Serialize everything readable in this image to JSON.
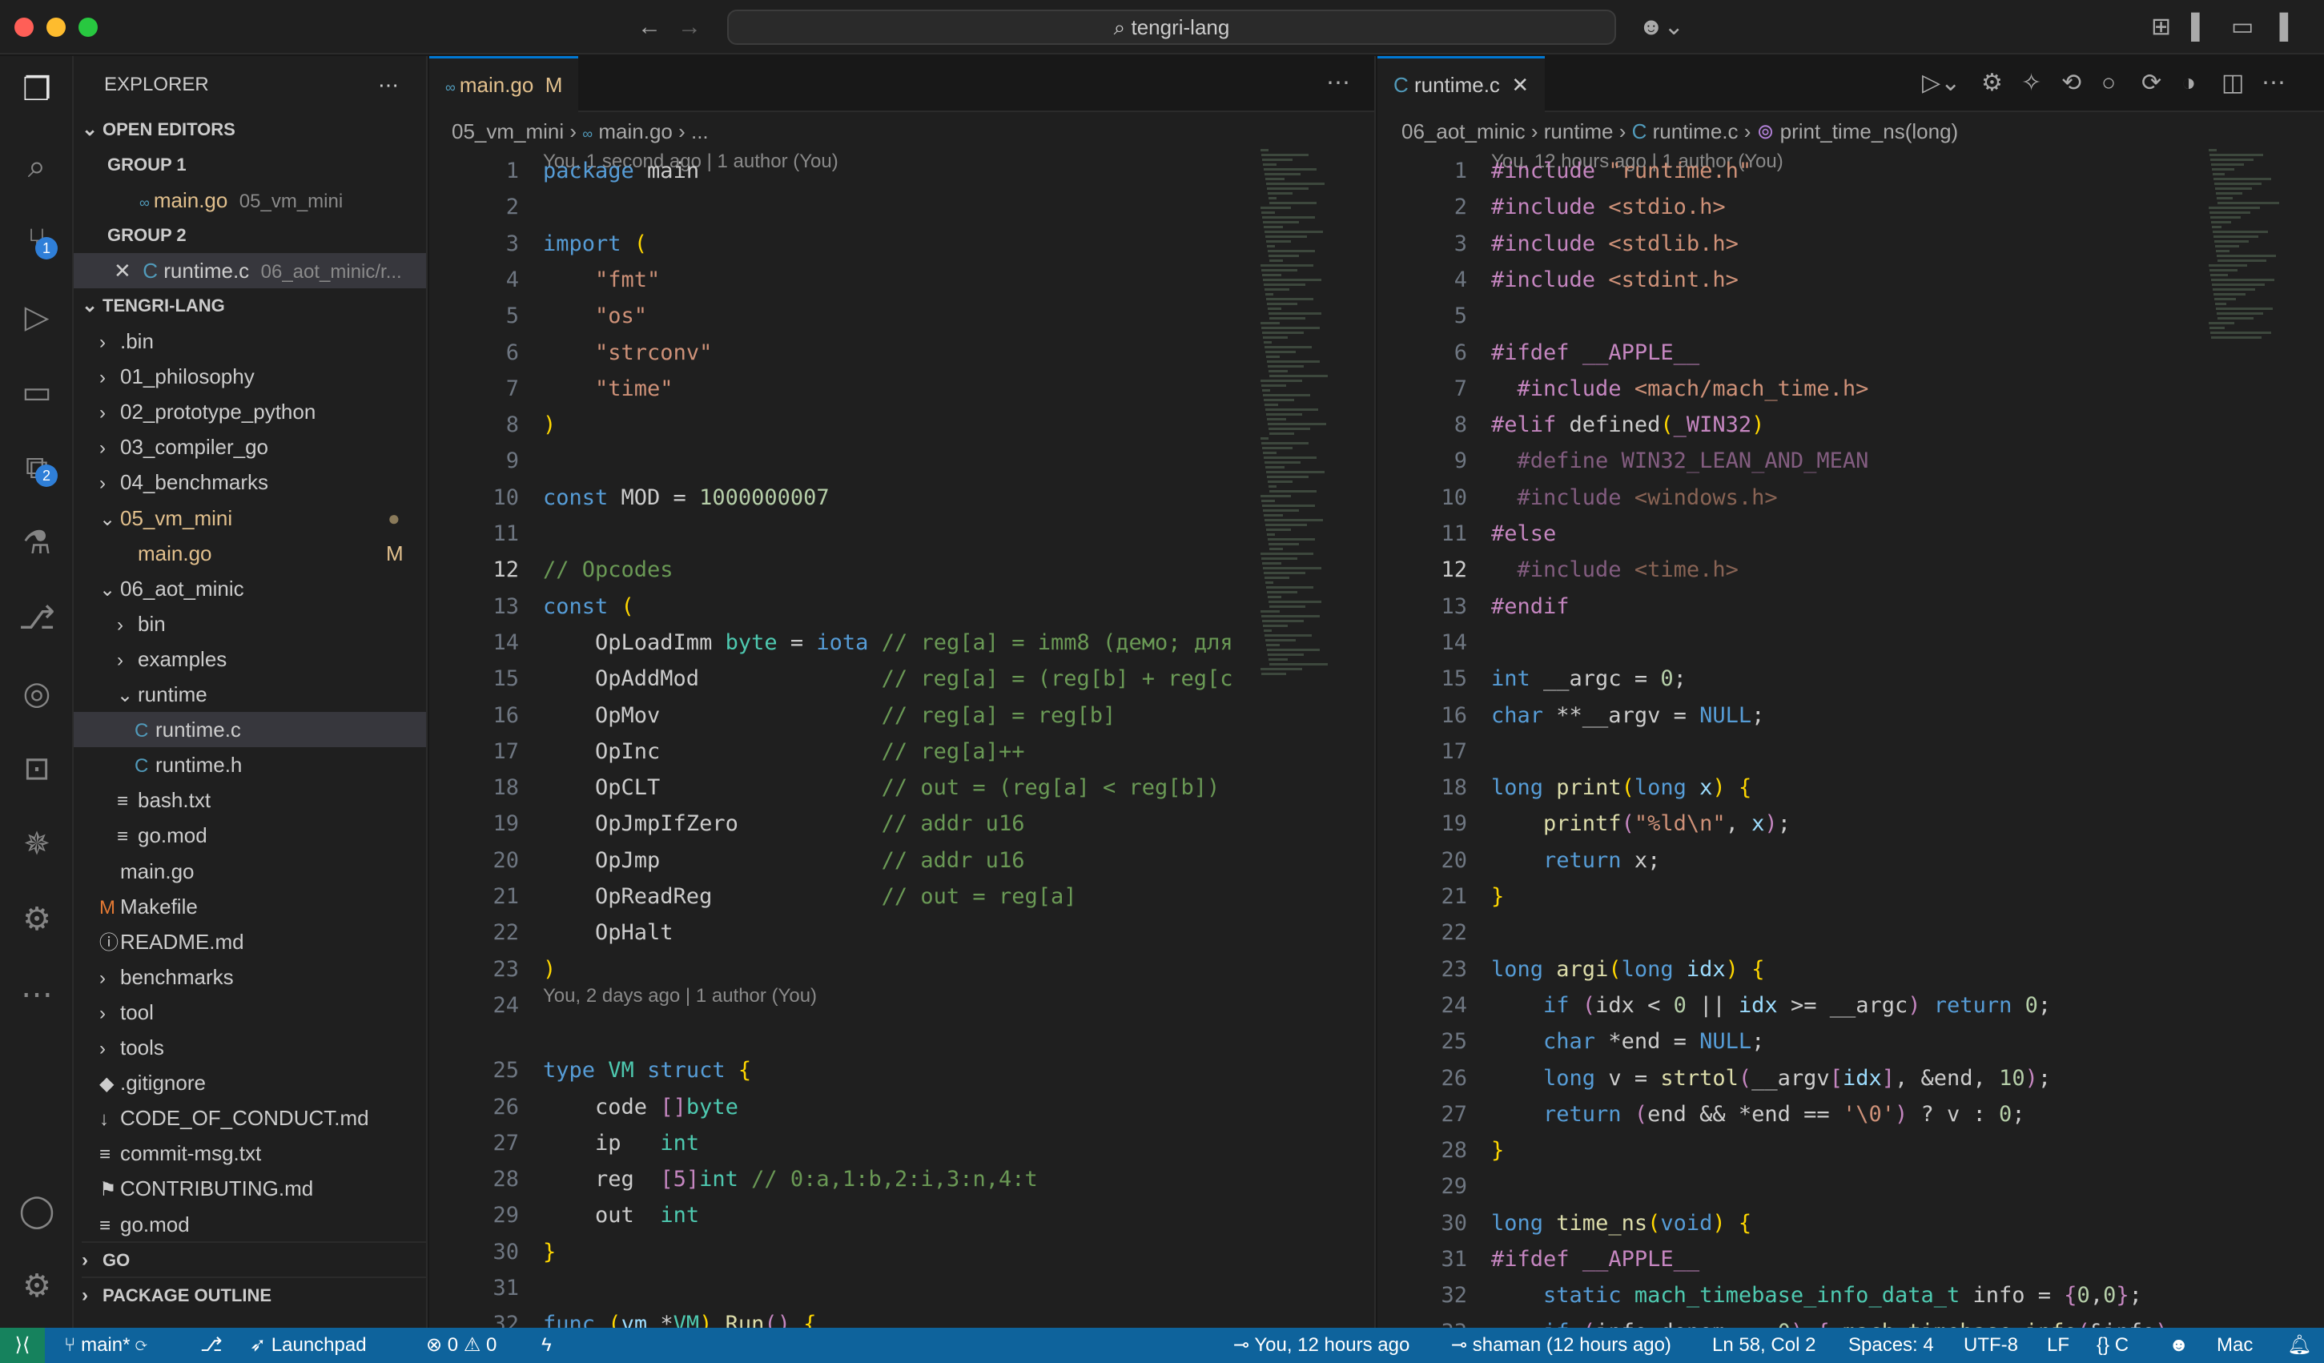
{
  "title": "tengri-lang",
  "sidebar": {
    "explorer": "EXPLORER",
    "open_editors": "OPEN EDITORS",
    "group1": "GROUP 1",
    "group2": "GROUP 2",
    "oe1_name": "main.go",
    "oe1_path": "05_vm_mini",
    "oe1_status": "M",
    "oe2_name": "runtime.c",
    "oe2_path": "06_aot_minic/r...",
    "project": "TENGRI-LANG",
    "tree": [
      {
        "label": "›",
        "name": ".bin"
      },
      {
        "label": "›",
        "name": "01_philosophy"
      },
      {
        "label": "›",
        "name": "02_prototype_python"
      },
      {
        "label": "›",
        "name": "03_compiler_go"
      },
      {
        "label": "›",
        "name": "04_benchmarks"
      },
      {
        "label": "⌄",
        "name": "05_vm_mini"
      },
      {
        "label": "",
        "name": "main.go",
        "status": "M"
      },
      {
        "label": "⌄",
        "name": "06_aot_minic"
      },
      {
        "label": "›",
        "name": "bin"
      },
      {
        "label": "›",
        "name": "examples"
      },
      {
        "label": "⌄",
        "name": "runtime"
      },
      {
        "label": "C",
        "name": "runtime.c"
      },
      {
        "label": "C",
        "name": "runtime.h"
      },
      {
        "label": "≡",
        "name": "bash.txt"
      },
      {
        "label": "≡",
        "name": "go.mod"
      },
      {
        "label": "",
        "name": "main.go"
      },
      {
        "label": "M",
        "name": "Makefile"
      },
      {
        "label": "ⓘ",
        "name": "README.md"
      },
      {
        "label": "›",
        "name": "benchmarks"
      },
      {
        "label": "›",
        "name": "tool"
      },
      {
        "label": "›",
        "name": "tools"
      },
      {
        "label": "◆",
        "name": ".gitignore"
      },
      {
        "label": "↓",
        "name": "CODE_OF_CONDUCT.md"
      },
      {
        "label": "≡",
        "name": "commit-msg.txt"
      },
      {
        "label": "⚑",
        "name": "CONTRIBUTING.md"
      },
      {
        "label": "≡",
        "name": "go.mod"
      }
    ],
    "go": "GO",
    "outline": "PACKAGE OUTLINE"
  },
  "left": {
    "tab": "main.go",
    "tab_status": "M",
    "crumb1": "05_vm_mini",
    "crumb2": "main.go",
    "crumb3": "...",
    "blame1": "You, 1 second ago | 1 author (You)",
    "blame2": "You, 2 days ago | 1 author (You)"
  },
  "right": {
    "tab": "runtime.c",
    "crumb1": "06_aot_minic",
    "crumb2": "runtime",
    "crumb3": "runtime.c",
    "crumb4": "print_time_ns(long)",
    "blame1": "You, 12 hours ago | 1 author (You)"
  },
  "status": {
    "branch": "main*",
    "launchpad": "Launchpad",
    "errors": "0",
    "warnings": "0",
    "blame": "You, 12 hours ago",
    "author": "shaman (12 hours ago)",
    "pos": "Ln 58, Col 2",
    "spaces": "Spaces: 4",
    "enc": "UTF-8",
    "eol": "LF",
    "lang": "C",
    "mac": "Mac"
  },
  "colors": {
    "accent": "#0078d4",
    "status": "#0e639c"
  }
}
